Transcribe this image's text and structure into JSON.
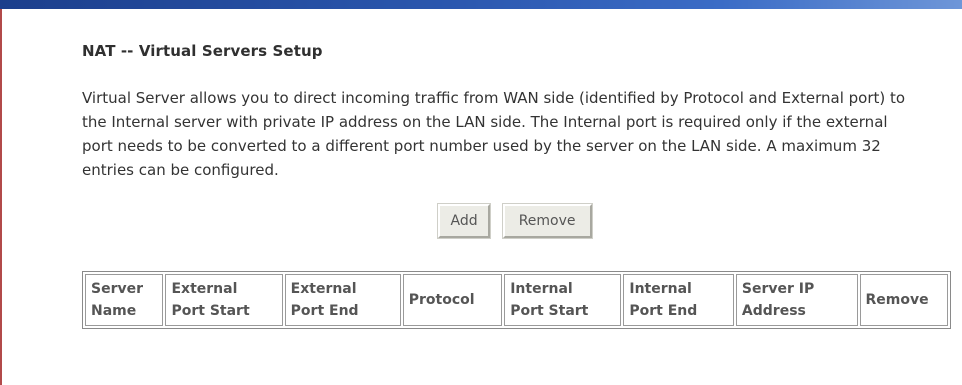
{
  "page": {
    "title": "NAT -- Virtual Servers Setup",
    "description": "Virtual Server allows you to direct incoming traffic from WAN side (identified by Protocol and External port) to the Internal server with private IP address on the LAN side. The Internal port is required only if the external port needs to be converted to a different port number used by the server on the LAN side. A maximum 32 entries can be configured."
  },
  "buttons": {
    "add_label": "Add",
    "remove_label": "Remove"
  },
  "table": {
    "headers": [
      {
        "line1": "Server",
        "line2": "Name"
      },
      {
        "line1": "External",
        "line2": "Port Start"
      },
      {
        "line1": "External",
        "line2": "Port End"
      },
      {
        "line1": "Protocol",
        "line2": ""
      },
      {
        "line1": "Internal",
        "line2": "Port Start"
      },
      {
        "line1": "Internal",
        "line2": "Port End"
      },
      {
        "line1": "Server IP",
        "line2": "Address"
      },
      {
        "line1": "Remove",
        "line2": ""
      }
    ],
    "rows": []
  },
  "colors": {
    "accent_bar": "#2a56ad",
    "left_border": "#b24a4a",
    "button_bg": "#ecece6"
  }
}
